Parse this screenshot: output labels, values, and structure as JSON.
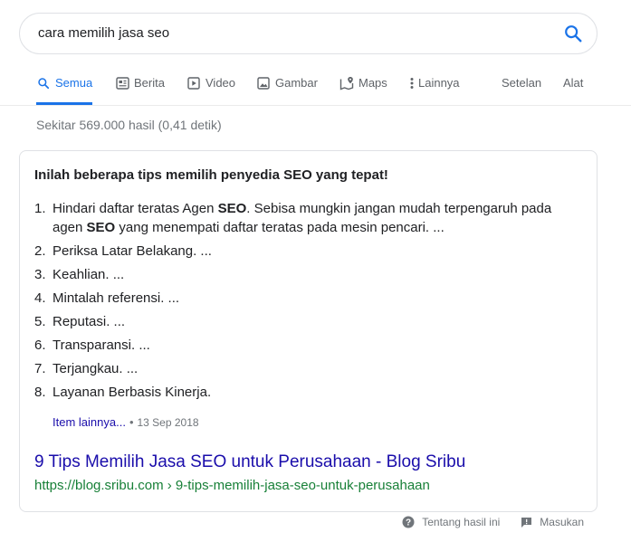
{
  "search": {
    "query": "cara memilih jasa seo"
  },
  "tabs": [
    {
      "label": "Semua",
      "icon": "search-icon",
      "active": true
    },
    {
      "label": "Berita",
      "icon": "news-icon"
    },
    {
      "label": "Video",
      "icon": "video-icon"
    },
    {
      "label": "Gambar",
      "icon": "image-icon"
    },
    {
      "label": "Maps",
      "icon": "map-icon"
    },
    {
      "label": "Lainnya",
      "icon": "more-vert-icon"
    },
    {
      "label": "Setelan"
    },
    {
      "label": "Alat"
    }
  ],
  "stats": "Sekitar 569.000 hasil (0,41 detik)",
  "snippet": {
    "heading": "Inilah beberapa tips memilih penyedia SEO yang tepat!",
    "tips": [
      {
        "num": "1.",
        "parts": [
          "Hindari daftar teratas Agen ",
          "SEO",
          ". Sebisa mungkin jangan mudah terpengaruh pada agen ",
          "SEO",
          " yang menempati daftar teratas pada mesin pencari. ..."
        ]
      },
      {
        "num": "2.",
        "text": "Periksa Latar Belakang. ..."
      },
      {
        "num": "3.",
        "text": "Keahlian. ..."
      },
      {
        "num": "4.",
        "text": "Mintalah referensi. ..."
      },
      {
        "num": "5.",
        "text": "Reputasi. ..."
      },
      {
        "num": "6.",
        "text": "Transparansi. ..."
      },
      {
        "num": "7.",
        "text": "Terjangkau. ..."
      },
      {
        "num": "8.",
        "text": "Layanan Berbasis Kinerja."
      }
    ],
    "more_label": "Item lainnya...",
    "separator": "•",
    "date": "13 Sep 2018",
    "result_title": "9 Tips Memilih Jasa SEO untuk Perusahaan - Blog Sribu",
    "result_url": "https://blog.sribu.com › 9-tips-memilih-jasa-seo-untuk-perusahaan"
  },
  "footer": {
    "about_label": "Tentang hasil ini",
    "feedback_label": "Masukan"
  },
  "colors": {
    "accent": "#1a73e8",
    "link": "#1a0dab",
    "url": "#188038"
  }
}
